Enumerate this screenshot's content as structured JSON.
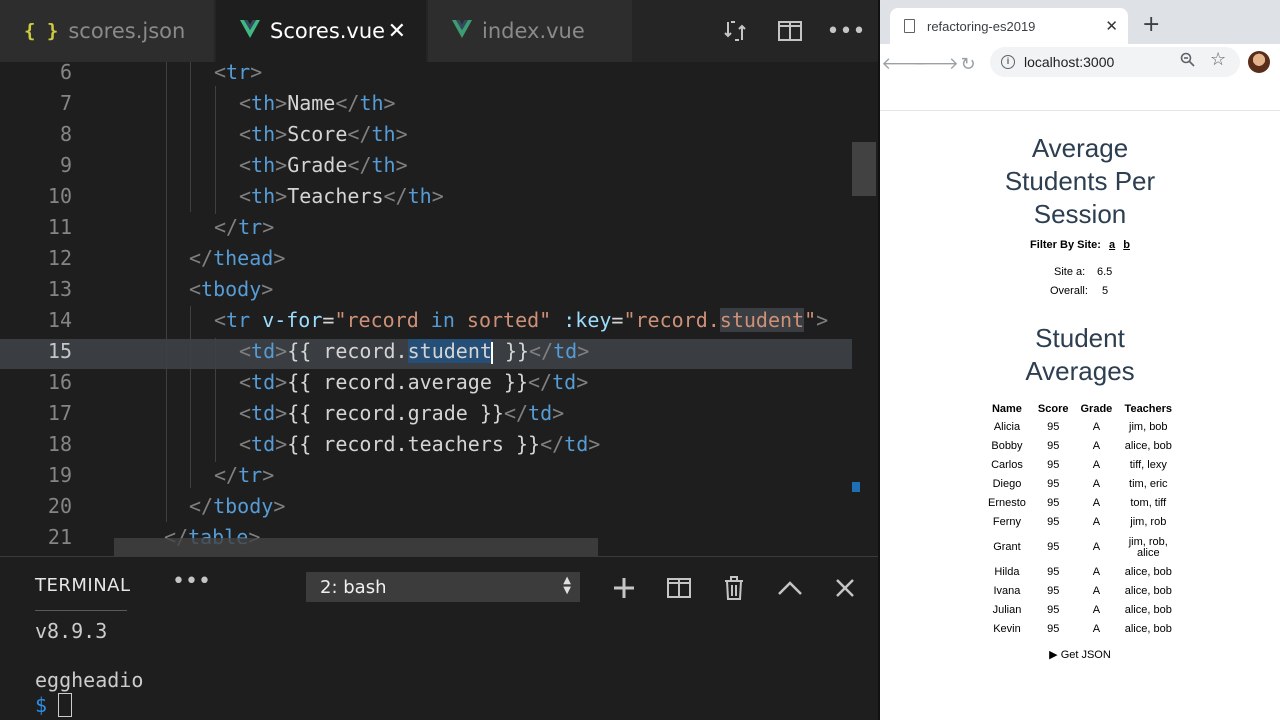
{
  "editor": {
    "tabs": [
      {
        "label": "scores.json",
        "icon": "json-braces-icon"
      },
      {
        "label": "Scores.vue",
        "icon": "vue-icon",
        "close": "✕"
      },
      {
        "label": "index.vue",
        "icon": "vue-icon"
      }
    ],
    "lines": [
      {
        "n": "6"
      },
      {
        "n": "7"
      },
      {
        "n": "8"
      },
      {
        "n": "9"
      },
      {
        "n": "10"
      },
      {
        "n": "11"
      },
      {
        "n": "12"
      },
      {
        "n": "13"
      },
      {
        "n": "14"
      },
      {
        "n": "15"
      },
      {
        "n": "16"
      },
      {
        "n": "17"
      },
      {
        "n": "18"
      },
      {
        "n": "19"
      },
      {
        "n": "20"
      },
      {
        "n": "21"
      }
    ],
    "code": {
      "l7_text": "Name",
      "l8_text": "Score",
      "l9_text": "Grade",
      "l10_text": "Teachers",
      "tr": "tr",
      "th": "th",
      "thead": "thead",
      "tbody": "tbody",
      "td": "td",
      "table": "table",
      "vfor_attr": "v-for",
      "vfor_val_a": "\"record ",
      "vfor_kw": "in",
      "vfor_val_b": " sorted\"",
      "key_attr": ":key",
      "key_val_a": "\"record.",
      "key_val_sel": "student",
      "key_val_b": "\"",
      "l15_a": "{{ record.",
      "l15_sel_a": "stu",
      "l15_sel_b": "dent",
      "l15_b": " }}",
      "l16": "{{ record.average }}",
      "l17": "{{ record.grade }}",
      "l18": "{{ record.teachers }}"
    }
  },
  "terminal": {
    "title": "TERMINAL",
    "more": "•••",
    "shell_select": "2: bash",
    "output": [
      "v8.9.3",
      "",
      "eggheadio"
    ],
    "prompt": "$"
  },
  "browser": {
    "tab_title": "refactoring-es2019",
    "url": "localhost:3000",
    "page": {
      "title1_l1": "Average",
      "title1_l2": "Students Per",
      "title1_l3": "Session",
      "filter_label": "Filter By Site:",
      "filter_links": [
        "a",
        "b"
      ],
      "stats": [
        {
          "label": "Site a:",
          "value": "6.5"
        },
        {
          "label": "Overall:",
          "value": "5"
        }
      ],
      "title2_l1": "Student",
      "title2_l2": "Averages",
      "table_headers": [
        "Name",
        "Score",
        "Grade",
        "Teachers"
      ],
      "rows": [
        [
          "Alicia",
          "95",
          "A",
          "jim, bob"
        ],
        [
          "Bobby",
          "95",
          "A",
          "alice, bob"
        ],
        [
          "Carlos",
          "95",
          "A",
          "tiff, lexy"
        ],
        [
          "Diego",
          "95",
          "A",
          "tim, eric"
        ],
        [
          "Ernesto",
          "95",
          "A",
          "tom, tiff"
        ],
        [
          "Ferny",
          "95",
          "A",
          "jim, rob"
        ],
        [
          "Grant",
          "95",
          "A",
          "jim, rob, alice"
        ],
        [
          "Hilda",
          "95",
          "A",
          "alice, bob"
        ],
        [
          "Ivana",
          "95",
          "A",
          "alice, bob"
        ],
        [
          "Julian",
          "95",
          "A",
          "alice, bob"
        ],
        [
          "Kevin",
          "95",
          "A",
          "alice, bob"
        ]
      ],
      "get_json": "▶ Get JSON"
    }
  },
  "colors": {
    "editor_bg": "#1e1e1e",
    "tag": "#569cd6",
    "attr": "#9cdcfe",
    "string": "#ce9178",
    "selection": "#264f78",
    "vue_green": "#41b883",
    "page_heading": "#2c3e50"
  }
}
